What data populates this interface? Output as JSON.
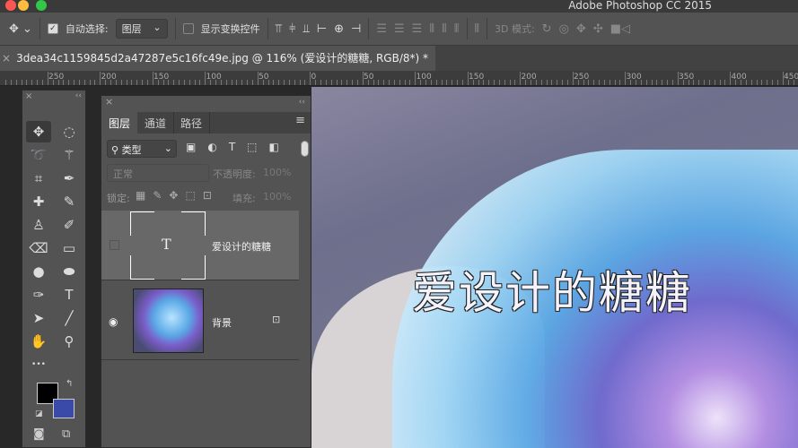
{
  "app_title": "Adobe Photoshop CC 2015",
  "options": {
    "auto_select_label": "自动选择:",
    "auto_select_value": "图层",
    "auto_select_checked": true,
    "show_transform_label": "显示变换控件",
    "show_transform_checked": false,
    "mode_3d_label": "3D 模式:"
  },
  "document_tab": {
    "title": "3dea34c1159845d2a47287e5c16fc49e.jpg @ 116% (爱设计的糖糖, RGB/8*) *",
    "close": "×"
  },
  "ruler": [
    "250",
    "200",
    "150",
    "100",
    "50",
    "0",
    "50",
    "100",
    "150",
    "200",
    "250",
    "300",
    "350",
    "400",
    "450"
  ],
  "layers_panel": {
    "tabs": [
      "图层",
      "通道",
      "路径"
    ],
    "filter_label": "类型",
    "blend_mode": "正常",
    "opacity_label": "不透明度:",
    "opacity_value": "100%",
    "lock_label": "锁定:",
    "fill_label": "填充:",
    "fill_value": "100%",
    "layers": [
      {
        "name": "爱设计的糖糖",
        "type": "text",
        "visible": false,
        "selected": true,
        "thumb_glyph": "T"
      },
      {
        "name": "背景",
        "type": "image",
        "visible": true,
        "locked": true
      }
    ]
  },
  "canvas_text": "爱设计的糖糖",
  "colors": {
    "foreground": "#000000",
    "background": "#3a4aa8"
  }
}
